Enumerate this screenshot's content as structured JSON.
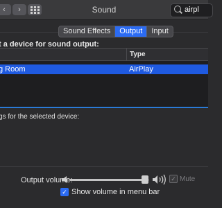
{
  "window": {
    "title": "Sound"
  },
  "toolbar": {
    "back_glyph": "‹",
    "forward_glyph": "›",
    "search": {
      "value": "airpl"
    }
  },
  "tabs": [
    {
      "label": "Sound Effects",
      "active": false
    },
    {
      "label": "Output",
      "active": true
    },
    {
      "label": "Input",
      "active": false
    }
  ],
  "output": {
    "prompt": "t a device for sound output:",
    "columns": [
      "",
      "Type"
    ],
    "rows": [
      {
        "name": "g Room",
        "type": "AirPlay",
        "selected": true
      }
    ],
    "settings_label": "gs for the selected device:"
  },
  "volume": {
    "label": "Output volume:",
    "level": 0.95,
    "mute_label": "Mute",
    "mute_checked": true,
    "mute_enabled": false,
    "show_in_menubar_label": "Show volume in menu bar",
    "show_in_menubar_checked": true
  },
  "colors": {
    "accent": "#2b6bf3",
    "selection": "#1f5ae0",
    "background": "#2b2b2d"
  }
}
